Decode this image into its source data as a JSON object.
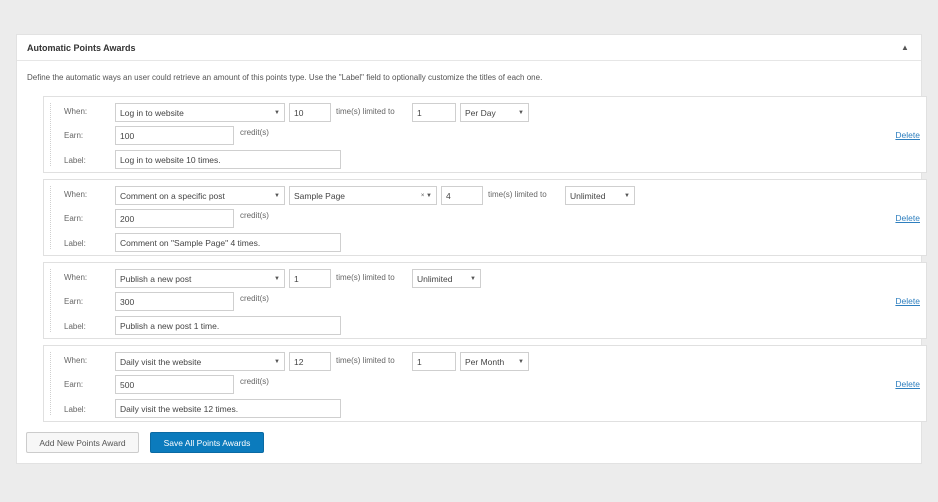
{
  "panel": {
    "title": "Automatic Points Awards",
    "collapse_icon": "caret-up-icon",
    "description": "Define the automatic ways an user could retrieve an amount of this points type. Use the \"Label\" field to optionally customize the titles of each one."
  },
  "labels": {
    "when": "When:",
    "earn": "Earn:",
    "label": "Label:"
  },
  "texts": {
    "times_limited": "time(s) limited to",
    "credits": "credit(s)",
    "delete": "Delete"
  },
  "awards": [
    {
      "when": "Log in to website",
      "times": "10",
      "limit": "1",
      "period": "Per Day",
      "earn": "100",
      "label": "Log in to website 10 times."
    },
    {
      "when": "Comment on a specific post",
      "post": "Sample Page",
      "times": "4",
      "period": "Unlimited",
      "earn": "200",
      "label": "Comment on \"Sample Page\" 4 times."
    },
    {
      "when": "Publish a new post",
      "times": "1",
      "period": "Unlimited",
      "earn": "300",
      "label": "Publish a new post 1 time."
    },
    {
      "when": "Daily visit the website",
      "times": "12",
      "limit": "1",
      "period": "Per Month",
      "earn": "500",
      "label": "Daily visit the website 12 times."
    }
  ],
  "buttons": {
    "add": "Add New Points Award",
    "save": "Save All Points Awards"
  },
  "colors": {
    "primary": "#0b7bbd",
    "link": "#2e7fbf"
  }
}
